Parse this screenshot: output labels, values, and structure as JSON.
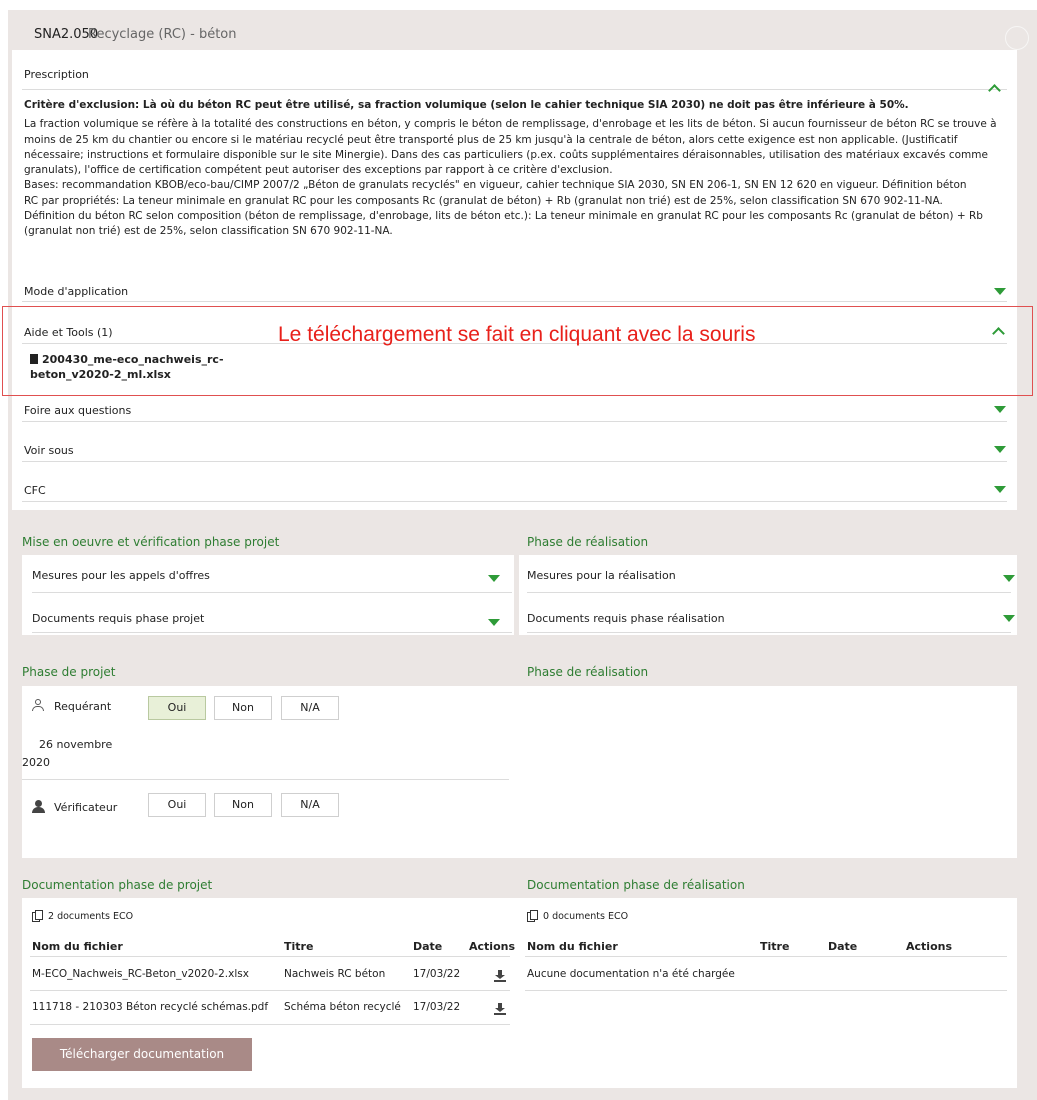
{
  "header": {
    "code": "SNA2.050",
    "name": "Recyclage (RC) - béton"
  },
  "prescription": {
    "title": "Prescription",
    "bold": "Critère d'exclusion: Là où du béton RC peut être utilisé, sa fraction volumique (selon le cahier technique SIA 2030) ne doit pas être inférieure à 50%.",
    "lines": [
      "La fraction volumique se réfère à la totalité des constructions en béton, y compris le béton de remplissage, d'enrobage et les lits de béton. Si aucun fournisseur de béton RC se trouve à",
      "moins de 25 km du chantier ou encore si le matériau recyclé peut être transporté plus de 25 km jusqu'à la centrale de béton, alors cette exigence est non applicable. (Justificatif",
      "nécessaire; instructions et formulaire disponible sur le site Minergie). Dans des cas particuliers (p.ex. coûts supplémentaires déraisonnables, utilisation des matériaux excavés comme",
      "granulats), l'office de certification compétent peut autoriser des exceptions par rapport à ce critère d'exclusion.",
      "Bases: recommandation KBOB/eco-bau/CIMP 2007/2 „Béton de granulats recyclés\" en vigueur, cahier technique SIA 2030, SN EN 206-1, SN EN 12 620 en vigueur. Définition béton",
      "RC par propriétés: La teneur minimale en granulat RC pour les composants Rc (granulat de béton) + Rb (granulat non trié) est de 25%, selon classification SN 670 902-11-NA.",
      "Définition du béton RC selon composition (béton de remplissage, d'enrobage, lits de béton etc.): La teneur minimale en granulat RC pour les composants Rc (granulat de béton) + Rb",
      "(granulat non trié) est de 25%, selon classification SN 670 902-11-NA."
    ]
  },
  "sections": {
    "mode": "Mode d'application",
    "aide": "Aide et Tools (1)",
    "aide_file_line1": "200430_me-eco_nachweis_rc-",
    "aide_file_line2": "beton_v2020-2_ml.xlsx",
    "faq": "Foire aux questions",
    "voir": "Voir sous",
    "cfc": "CFC"
  },
  "annotation": "Le téléchargement se fait en cliquant avec la souris",
  "mise_en_oeuvre": {
    "title_left": "Mise en oeuvre et vérification phase projet",
    "title_right": "Phase de réalisation",
    "left_items": [
      "Mesures pour les appels d'offres",
      "Documents requis phase projet"
    ],
    "right_items": [
      "Mesures pour la réalisation",
      "Documents requis phase réalisation"
    ]
  },
  "phase": {
    "title_left": "Phase de projet",
    "title_right": "Phase de réalisation",
    "requerant_label": "Requérant",
    "verificateur_label": "Vérificateur",
    "options": [
      "Oui",
      "Non",
      "N/A"
    ],
    "requerant_selected": "Oui",
    "date_line1": "26 novembre",
    "date_line2": "2020"
  },
  "documentation": {
    "title_left": "Documentation phase de projet",
    "title_right": "Documentation phase de réalisation",
    "count_left": "2 documents ECO",
    "count_right": "0 documents ECO",
    "columns": [
      "Nom du fichier",
      "Titre",
      "Date",
      "Actions"
    ],
    "rows": [
      {
        "file": "M-ECO_Nachweis_RC-Beton_v2020-2.xlsx",
        "title": "Nachweis RC béton",
        "date": "17/03/22"
      },
      {
        "file": "111718 - 210303 Béton recyclé schémas.pdf",
        "title": "Schéma béton recyclé",
        "date": "17/03/22"
      }
    ],
    "empty_right": "Aucune documentation n'a été chargée",
    "download_button": "Télécharger documentation"
  }
}
